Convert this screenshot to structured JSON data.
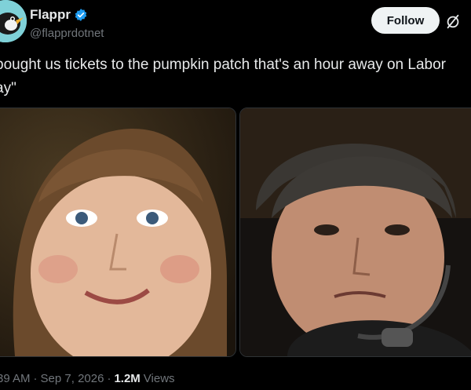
{
  "author": {
    "name": "Flappr",
    "handle": "@flapprdotnet",
    "verified": true
  },
  "actions": {
    "follow_label": "Follow",
    "grok_icon": "slash-circle-icon"
  },
  "tweet": {
    "text": "bought us tickets to the pumpkin patch that's an hour away on Labor\nay\""
  },
  "media": [
    {
      "alt_icon": "photo-woman-smiling"
    },
    {
      "alt_icon": "photo-man-with-headphones"
    }
  ],
  "meta": {
    "time": "39 AM",
    "sep1": "·",
    "date": "Sep 7, 2026",
    "sep2": "·",
    "views_count": "1.2M",
    "views_label": "Views"
  },
  "colors": {
    "background": "#000000",
    "text": "#e7e9ea",
    "muted": "#71767b",
    "verified": "#1d9bf0",
    "follow_bg": "#eff3f4"
  }
}
